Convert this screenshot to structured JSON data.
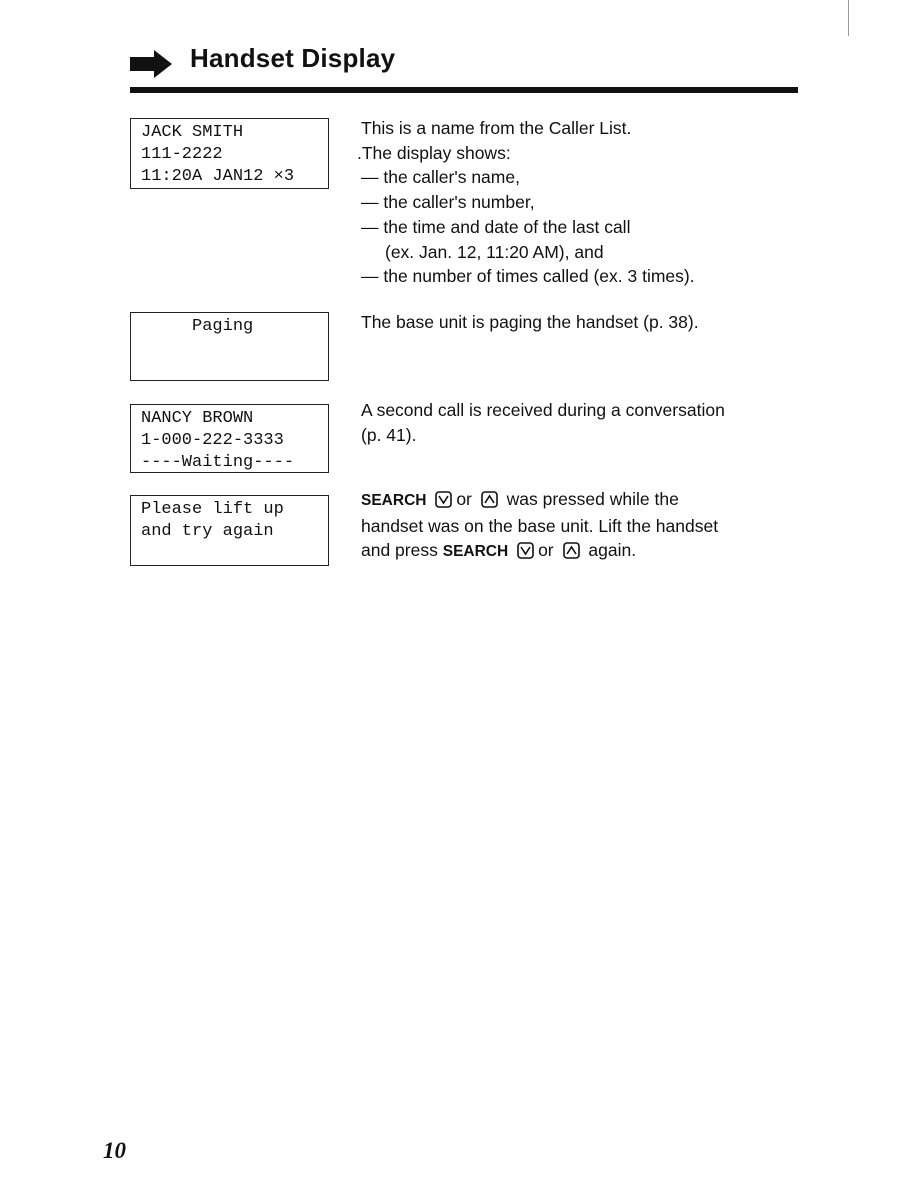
{
  "header": {
    "title": "Handset Display",
    "icon": "right-arrow-icon"
  },
  "entries": [
    {
      "display": [
        "JACK SMITH",
        "111-2222",
        "11:20A JAN12 ×3"
      ],
      "description": [
        "This is a name from the Caller List.",
        ".The display shows:",
        "— the caller's name,",
        "— the caller's number,",
        "— the time and date of the last call",
        "(ex. Jan. 12, 11:20 AM), and",
        "— the number of times called (ex. 3 times)."
      ]
    },
    {
      "display": [
        "     Paging"
      ],
      "description": [
        "The base unit is paging the handset (p. 38)."
      ]
    },
    {
      "display": [
        "NANCY BROWN",
        "1-000-222-3333",
        "----Waiting----"
      ],
      "description": [
        "A second call is received during a conversation",
        "(p. 41)."
      ]
    },
    {
      "display": [
        "Please lift up",
        "and try again"
      ],
      "description": {
        "search": "SEARCH",
        "or": "or",
        "line1_end": "was pressed while the",
        "line2": "handset was on the base unit. Lift the handset",
        "line3_start": "and press",
        "line3_end": "again.",
        "keys": [
          "down-key-icon",
          "up-key-icon"
        ]
      }
    }
  ],
  "footer": {
    "page_number": "10"
  }
}
